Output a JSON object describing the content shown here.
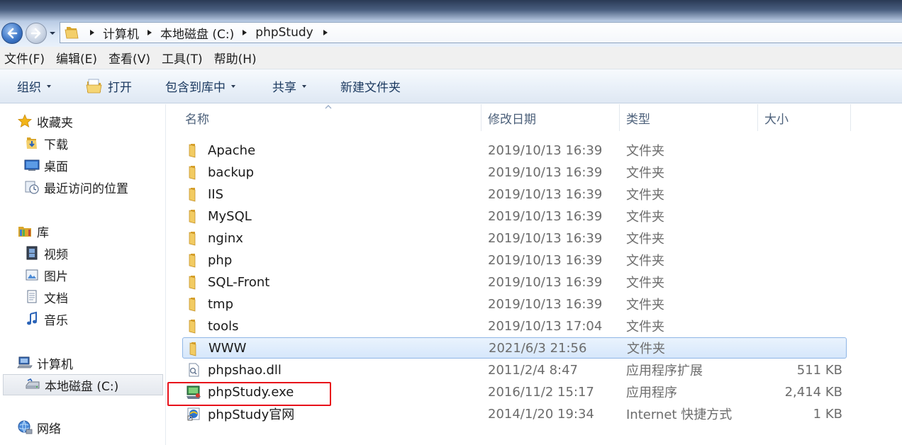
{
  "address": {
    "crumbs": [
      "计算机",
      "本地磁盘 (C:)",
      "phpStudy"
    ]
  },
  "menu": [
    "文件(F)",
    "编辑(E)",
    "查看(V)",
    "工具(T)",
    "帮助(H)"
  ],
  "toolbar": {
    "organize": "组织",
    "open": "打开",
    "include_library": "包含到库中",
    "share": "共享",
    "new_folder": "新建文件夹"
  },
  "nav": {
    "favorites": "收藏夹",
    "downloads": "下载",
    "desktop": "桌面",
    "recent": "最近访问的位置",
    "libraries": "库",
    "videos": "视频",
    "pictures": "图片",
    "documents": "文档",
    "music": "音乐",
    "computer": "计算机",
    "local_disk": "本地磁盘 (C:)",
    "network": "网络"
  },
  "columns": {
    "name": "名称",
    "modified": "修改日期",
    "type": "类型",
    "size": "大小"
  },
  "files": [
    {
      "name": "Apache",
      "date": "2019/10/13 16:39",
      "type": "文件夹",
      "size": "",
      "icon": "folder-icon"
    },
    {
      "name": "backup",
      "date": "2019/10/13 16:39",
      "type": "文件夹",
      "size": "",
      "icon": "folder-icon"
    },
    {
      "name": "IIS",
      "date": "2019/10/13 16:39",
      "type": "文件夹",
      "size": "",
      "icon": "folder-icon"
    },
    {
      "name": "MySQL",
      "date": "2019/10/13 16:39",
      "type": "文件夹",
      "size": "",
      "icon": "folder-icon"
    },
    {
      "name": "nginx",
      "date": "2019/10/13 16:39",
      "type": "文件夹",
      "size": "",
      "icon": "folder-icon"
    },
    {
      "name": "php",
      "date": "2019/10/13 16:39",
      "type": "文件夹",
      "size": "",
      "icon": "folder-icon"
    },
    {
      "name": "SQL-Front",
      "date": "2019/10/13 16:39",
      "type": "文件夹",
      "size": "",
      "icon": "folder-icon"
    },
    {
      "name": "tmp",
      "date": "2019/10/13 16:39",
      "type": "文件夹",
      "size": "",
      "icon": "folder-icon"
    },
    {
      "name": "tools",
      "date": "2019/10/13 17:04",
      "type": "文件夹",
      "size": "",
      "icon": "folder-icon"
    },
    {
      "name": "WWW",
      "date": "2021/6/3 21:56",
      "type": "文件夹",
      "size": "",
      "icon": "folder-icon",
      "selected": true
    },
    {
      "name": "phpshao.dll",
      "date": "2011/2/4 8:47",
      "type": "应用程序扩展",
      "size": "511 KB",
      "icon": "dll-icon"
    },
    {
      "name": "phpStudy.exe",
      "date": "2016/11/2 15:17",
      "type": "应用程序",
      "size": "2,414 KB",
      "icon": "exe-icon"
    },
    {
      "name": "phpStudy官网",
      "date": "2014/1/20 19:34",
      "type": "Internet 快捷方式",
      "size": "1 KB",
      "icon": "shortcut-icon"
    }
  ],
  "colors": {
    "highlight": "#e8111a",
    "selection": "#d6e7fb"
  }
}
